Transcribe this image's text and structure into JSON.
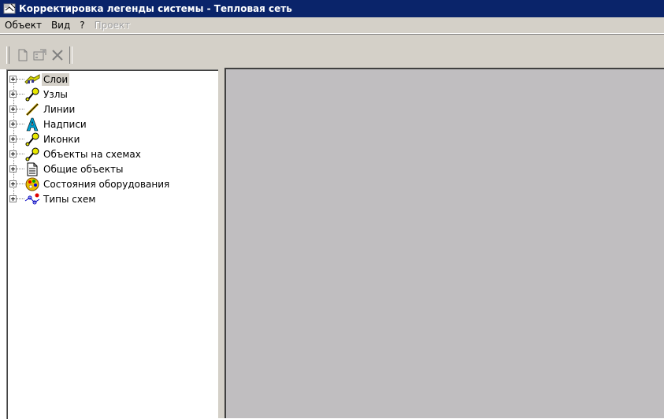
{
  "window": {
    "title": "Корректировка легенды системы - Тепловая сеть",
    "icon": "legend-app-icon"
  },
  "menu": [
    {
      "label": "Объект",
      "enabled": true
    },
    {
      "label": "Вид",
      "enabled": true
    },
    {
      "label": "?",
      "enabled": true
    },
    {
      "label": "Проект",
      "enabled": false
    }
  ],
  "toolbar": {
    "buttons": [
      {
        "icon": "new-document-icon",
        "enabled": false
      },
      {
        "icon": "properties-icon",
        "enabled": false
      },
      {
        "icon": "delete-icon",
        "enabled": false
      }
    ]
  },
  "tree": {
    "items": [
      {
        "label": "Слои",
        "icon": "layers-icon",
        "selected": true
      },
      {
        "label": "Узлы",
        "icon": "node-icon",
        "selected": false
      },
      {
        "label": "Линии",
        "icon": "line-icon",
        "selected": false
      },
      {
        "label": "Надписи",
        "icon": "text-label-icon",
        "selected": false
      },
      {
        "label": "Иконки",
        "icon": "node-icon",
        "selected": false
      },
      {
        "label": "Объекты на схемах",
        "icon": "node-icon",
        "selected": false
      },
      {
        "label": "Общие объекты",
        "icon": "document-icon",
        "selected": false
      },
      {
        "label": "Состояния оборудования",
        "icon": "palette-icon",
        "selected": false
      },
      {
        "label": "Типы схем",
        "icon": "scheme-types-icon",
        "selected": false
      }
    ]
  },
  "colors": {
    "titlebar": "#0a246a",
    "chrome": "#d4d0c8",
    "content_area": "#c0bec0",
    "selection": "#d4d0c8"
  }
}
